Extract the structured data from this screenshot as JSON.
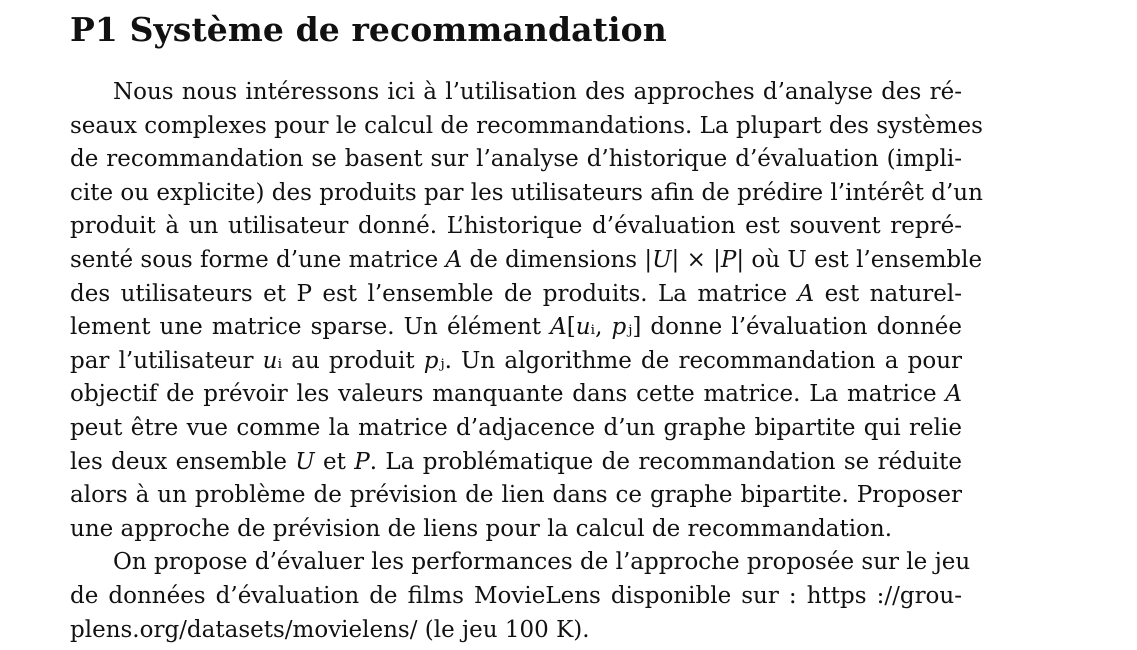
{
  "document": {
    "title": "P1 Système de recommandation",
    "paragraph1_lines": [
      "Nous nous intéressons ici à l’utilisation des approches d’analyse des ré-",
      "seaux complexes pour le calcul de recommandations. La plupart des systèmes",
      "de recommandation se basent sur l’analyse d’historique d’évaluation (impli-",
      "cite ou explicite) des produits par les utilisateurs afin de prédire l’intérêt d’un",
      "produit à un utilisateur donné. L’historique d’évaluation est souvent repré-",
      "senté sous forme d’une matrice 𝐴 de dimensions |𝑈| × |𝑃| où U est l’ensemble",
      "des utilisateurs et P est l’ensemble de produits. La matrice 𝐴 est naturel-",
      "lement une matrice sparse. Un élément 𝐴[𝑢ᵢ, 𝑝ⱼ] donne l’évaluation donnée",
      "par l’utilisateur 𝑢ᵢ au produit 𝑝ⱼ. Un algorithme de recommandation a pour",
      "objectif de prévoir les valeurs manquante dans cette matrice. La matrice 𝐴",
      "peut être vue comme la matrice d’adjacence d’un graphe bipartite qui relie",
      "les deux ensemble 𝑈 et 𝑃. La problématique de recommandation se réduite",
      "alors à un problème de prévision de lien dans ce graphe bipartite. Proposer",
      "une approche de prévision de liens pour la calcul de recommandation."
    ],
    "paragraph2_lines": [
      "On propose d’évaluer les performances de l’approche proposée sur le jeu",
      "de données d’évaluation de films MovieLens disponible sur : https ://grou-",
      "plens.org/datasets/movielens/ (le jeu 100 K)."
    ]
  }
}
